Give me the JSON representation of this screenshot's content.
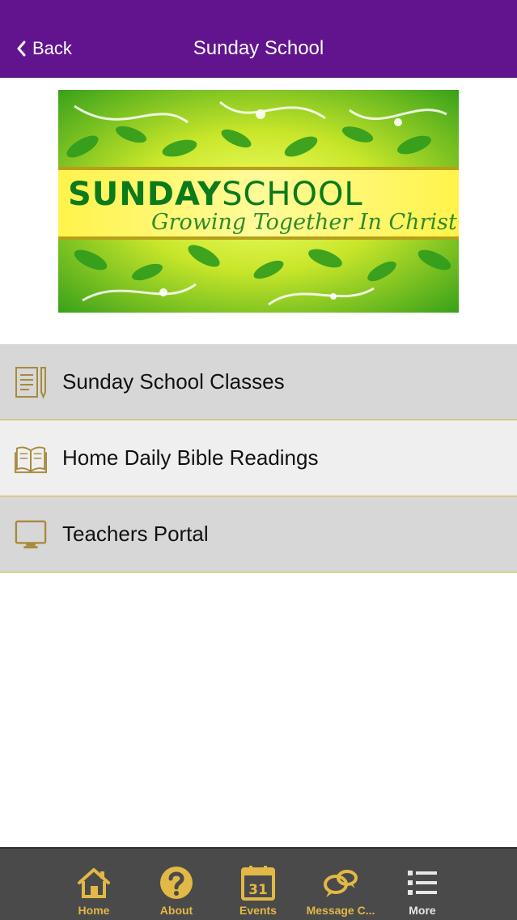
{
  "nav": {
    "back_label": "Back",
    "title": "Sunday School"
  },
  "banner": {
    "heading_bold": "SUNDAY",
    "heading_light": "SCHOOL",
    "tagline": "Growing Together In Christ"
  },
  "menu": {
    "items": [
      {
        "label": "Sunday School Classes",
        "icon": "document-pencil-icon"
      },
      {
        "label": "Home Daily Bible Readings",
        "icon": "open-book-icon"
      },
      {
        "label": "Teachers Portal",
        "icon": "monitor-icon"
      }
    ]
  },
  "tabbar": {
    "tabs": [
      {
        "label": "Home",
        "icon": "home-icon"
      },
      {
        "label": "About",
        "icon": "question-icon"
      },
      {
        "label": "Events",
        "icon": "calendar-icon",
        "calendar_day": "31"
      },
      {
        "label": "Message C...",
        "icon": "chat-bubbles-icon"
      },
      {
        "label": "More",
        "icon": "list-icon"
      }
    ]
  },
  "colors": {
    "navbar": "#62148e",
    "accent_gold": "#d4b13e",
    "tab_label_gold": "#e2b846",
    "tabbar_bg": "#4a4a4a",
    "menu_gray": "#d7d7d7",
    "menu_light": "#efefef",
    "banner_green": "#0b7a1b"
  }
}
